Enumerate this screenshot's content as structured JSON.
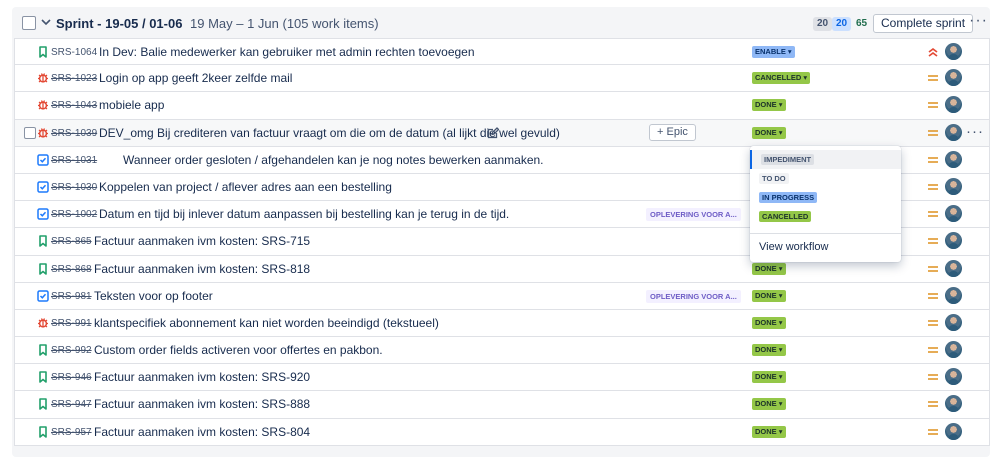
{
  "sprint": {
    "title": "Sprint - 19-05 / 01-06",
    "dates": "19 May – 1 Jun (105 work items)",
    "count_todo": "20",
    "count_inprogress": "20",
    "count_done": "65",
    "complete_label": "Complete sprint",
    "more_label": "···"
  },
  "rows": [
    {
      "key": "SRS-1064",
      "summary": "In Dev: Balie medewerker kan gebruiker met admin rechten toevoegen",
      "status": "ENABLE ▾"
    },
    {
      "key": "SRS-1023",
      "summary": "Login op app geeft 2keer zelfde mail",
      "status": "CANCELLED ▾"
    },
    {
      "key": "SRS-1043",
      "summary": "mobiele app",
      "status": "DONE ▾"
    },
    {
      "key": "SRS-1039",
      "summary": "DEV_omg Bij crediteren van factuur vraagt om die om de datum (al lijkt die wel gevuld)",
      "status": "DONE ▾",
      "epic_button": "+ Epic",
      "more": "···"
    },
    {
      "key": "SRS-1031",
      "summary": "Wanneer order gesloten / afgehandelen kan je nog notes bewerken aanmaken.",
      "status": ""
    },
    {
      "key": "SRS-1030",
      "summary": "Koppelen van project / aflever adres aan een bestelling",
      "status": ""
    },
    {
      "key": "SRS-1002",
      "summary": "Datum en tijd bij inlever datum aanpassen bij bestelling kan je terug in de tijd.",
      "epic": "OPLEVERING VOOR A...",
      "status": ""
    },
    {
      "key": "SRS-865",
      "summary": "Factuur aanmaken ivm kosten: SRS-715",
      "status": ""
    },
    {
      "key": "SRS-868",
      "summary": "Factuur aanmaken ivm kosten: SRS-818",
      "status": "DONE ▾"
    },
    {
      "key": "SRS-981",
      "summary": "Teksten voor op footer",
      "epic": "OPLEVERING VOOR A...",
      "status": "DONE ▾"
    },
    {
      "key": "SRS-991",
      "summary": "klantspecifiek abonnement kan niet worden beeindigd (tekstueel)",
      "status": "DONE ▾"
    },
    {
      "key": "SRS-992",
      "summary": "Custom order fields activeren voor offertes en pakbon.",
      "status": "DONE ▾"
    },
    {
      "key": "SRS-946",
      "summary": "Factuur aanmaken ivm kosten: SRS-920",
      "status": "DONE ▾"
    },
    {
      "key": "SRS-947",
      "summary": "Factuur aanmaken ivm kosten: SRS-888",
      "status": "DONE ▾"
    },
    {
      "key": "SRS-957",
      "summary": "Factuur aanmaken ivm kosten: SRS-804",
      "status": "DONE ▾"
    }
  ],
  "dropdown": {
    "impediment": "IMPEDIMENT",
    "todo": "TO DO",
    "inprogress": "IN PROGRESS",
    "cancelled": "CANCELLED",
    "view_workflow": "View workflow"
  },
  "colors": {
    "story_icon": "#22a06b",
    "bug_icon": "#e34935",
    "task_icon": "#1d7afc",
    "priority_medium": "#e2a03f",
    "priority_high": "#e34935"
  }
}
